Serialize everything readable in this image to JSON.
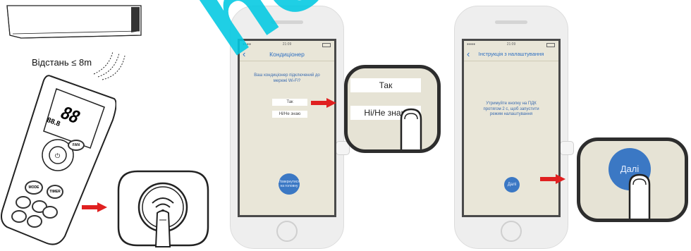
{
  "distance_label": "Відстань ≤ 8m",
  "remote": {
    "display_digits": "88",
    "display_small": "88.8",
    "buttons": {
      "mode": "MODE",
      "fan": "FAN",
      "timer": "TIMER",
      "on_off": "ON/OFF"
    }
  },
  "phone1": {
    "time": "21:09",
    "title": "Кондиціонер",
    "message": "Ваш кондиціонер підключений до мережі Wi-Fi?",
    "yes_label": "Так",
    "no_label": "Ні/Не знаю",
    "help_button": "Повернутися на головну"
  },
  "zoom1": {
    "yes_label": "Так",
    "no_label": "Ні/Не знаю"
  },
  "phone2": {
    "time": "21:09",
    "title": "Інструкція з налаштування",
    "message": "Утримуйте кнопку на ПДК протягом 2 с, щоб запустити режим налаштування",
    "next_button": "Далі"
  },
  "zoom2": {
    "next_button": "Далі"
  },
  "colors": {
    "arrow": "#e02020",
    "accent_blue": "#3b78c4",
    "screen_bg": "#e9e6d8",
    "watermark": "#00c8e1"
  }
}
